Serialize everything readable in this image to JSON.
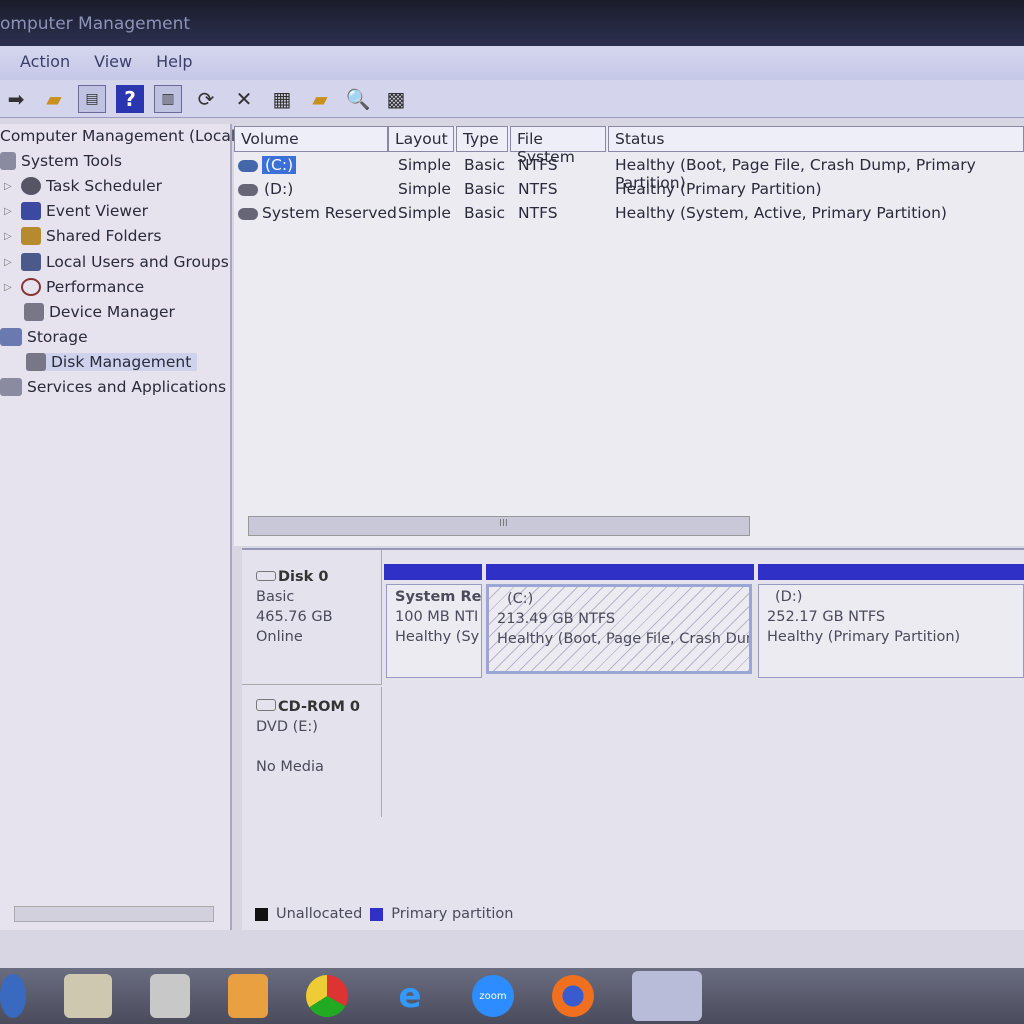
{
  "window": {
    "title": "omputer Management"
  },
  "menu": [
    "Action",
    "View",
    "Help"
  ],
  "tree": [
    {
      "label": "Computer Management (Local",
      "level": 0
    },
    {
      "label": "System Tools",
      "level": 0
    },
    {
      "label": "Task Scheduler",
      "level": 1
    },
    {
      "label": "Event Viewer",
      "level": 1
    },
    {
      "label": "Shared Folders",
      "level": 1
    },
    {
      "label": "Local Users and Groups",
      "level": 1
    },
    {
      "label": "Performance",
      "level": 1
    },
    {
      "label": "Device Manager",
      "level": 1
    },
    {
      "label": "Storage",
      "level": 0
    },
    {
      "label": "Disk Management",
      "level": 1
    },
    {
      "label": "Services and Applications",
      "level": 0
    }
  ],
  "columns": [
    "Volume",
    "Layout",
    "Type",
    "File System",
    "Status"
  ],
  "volumes": [
    {
      "volume": "(C:)",
      "layout": "Simple",
      "type": "Basic",
      "fs": "NTFS",
      "status": "Healthy (Boot, Page File, Crash Dump, Primary Partition)"
    },
    {
      "volume": "(D:)",
      "layout": "Simple",
      "type": "Basic",
      "fs": "NTFS",
      "status": "Healthy (Primary Partition)"
    },
    {
      "volume": "System Reserved",
      "layout": "Simple",
      "type": "Basic",
      "fs": "NTFS",
      "status": "Healthy (System, Active, Primary Partition)"
    }
  ],
  "scroll_grip": "III",
  "disk0": {
    "name": "Disk 0",
    "type": "Basic",
    "size": "465.76 GB",
    "state": "Online",
    "partitions": [
      {
        "name": "System Re",
        "size": "100 MB NTI",
        "status": "Healthy (Sy"
      },
      {
        "name": "(C:)",
        "size": "213.49 GB NTFS",
        "status": "Healthy (Boot, Page File, Crash Dum"
      },
      {
        "name": "(D:)",
        "size": "252.17 GB NTFS",
        "status": "Healthy (Primary Partition)"
      }
    ]
  },
  "cdrom": {
    "name": "CD-ROM 0",
    "drive": "DVD (E:)",
    "media": "No Media"
  },
  "legend": {
    "unallocated": "Unallocated",
    "primary": "Primary partition",
    "colors": {
      "unallocated": "#111111",
      "primary": "#2f30c6"
    }
  },
  "taskbar": {
    "zoom_label": "zoom"
  }
}
